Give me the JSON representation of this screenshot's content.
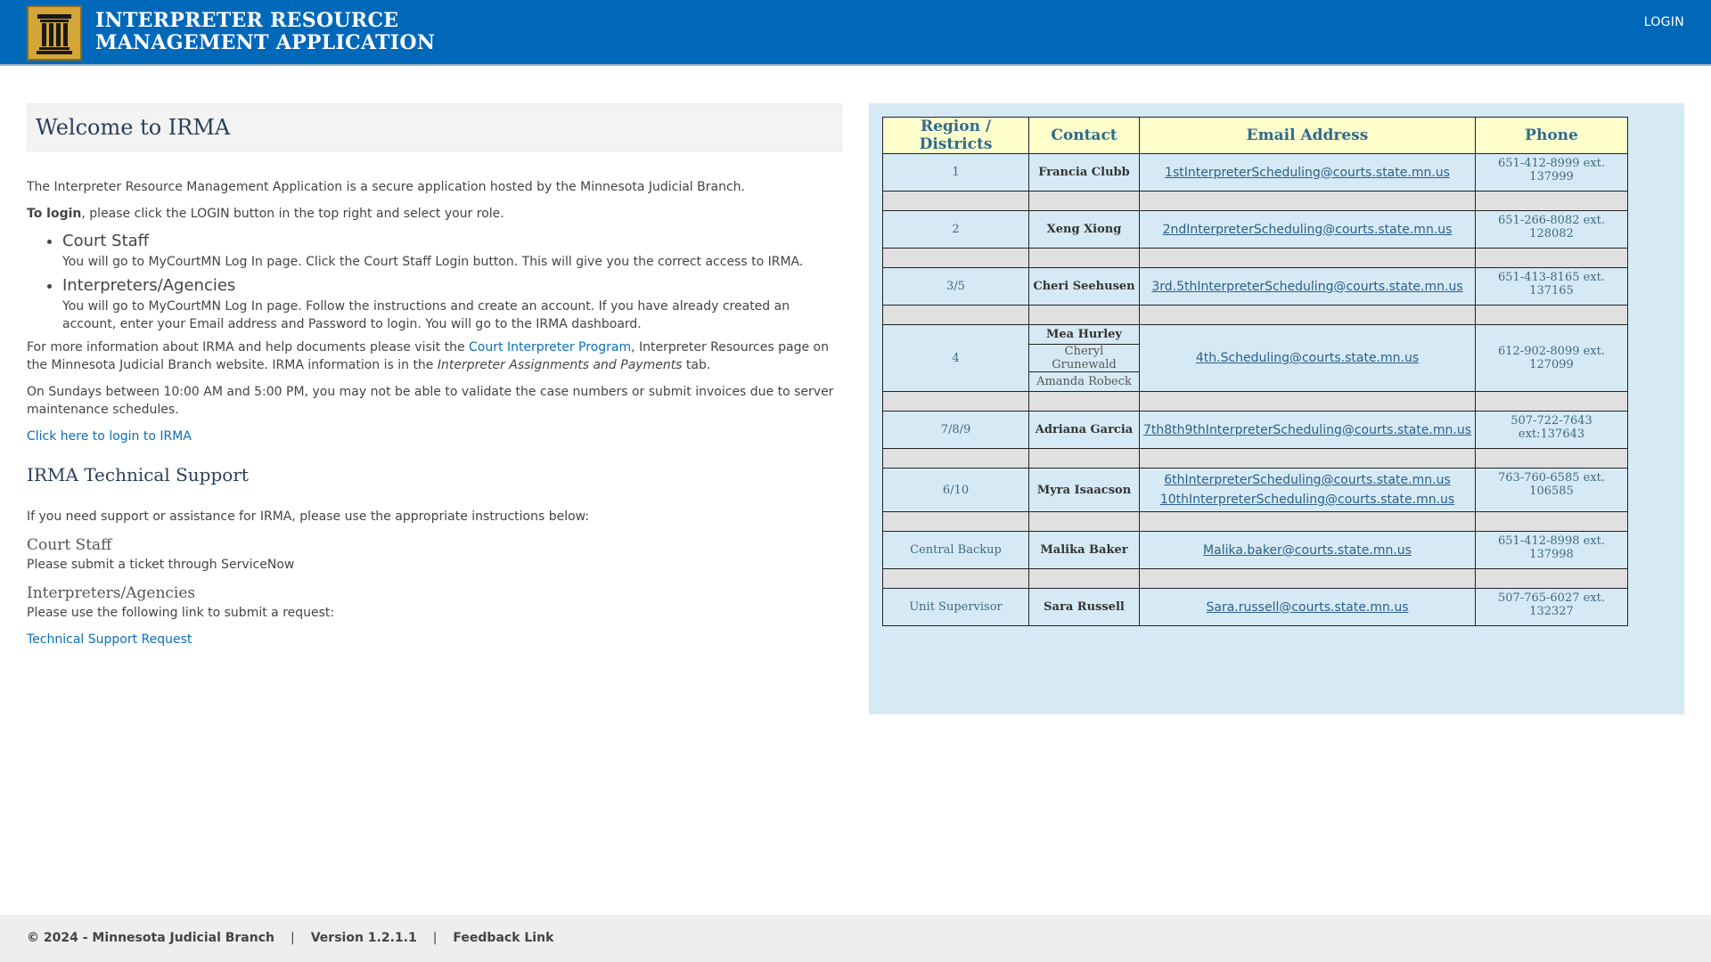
{
  "header": {
    "title_line1": "INTERPRETER RESOURCE",
    "title_line2": "MANAGEMENT APPLICATION",
    "login_label": "LOGIN",
    "logo_icon": "courthouse-pillar-icon"
  },
  "welcome": {
    "heading": "Welcome to IRMA",
    "intro": "The Interpreter Resource Management Application is a secure application hosted by the Minnesota Judicial Branch.",
    "login_bold": "To login",
    "login_rest": ", please click the LOGIN button in the top right and select your role.",
    "roles": [
      {
        "title": "Court Staff",
        "desc": "You will go to MyCourtMN Log In page. Click the Court Staff Login button. This will give you the correct access to IRMA."
      },
      {
        "title": "Interpreters/Agencies",
        "desc": "You will go to MyCourtMN Log In page. Follow the instructions and create an account. If you have already created an account, enter your Email address and Password to login. You will go to the IRMA dashboard."
      }
    ],
    "more_pre": "For more information about IRMA and help documents please visit the ",
    "more_link": "Court Interpreter Program",
    "more_mid": ", Interpreter Resources page on the Minnesota Judicial Branch website. IRMA information is in the ",
    "more_italic": "Interpreter Assignments and Payments",
    "more_post": " tab.",
    "sunday": "On Sundays between 10:00 AM and 5:00 PM, you may not be able to validate the case numbers or submit invoices due to server maintenance schedules.",
    "click_login": "Click here to login to IRMA"
  },
  "support": {
    "heading": "IRMA Technical Support",
    "intro": "If you need support or assistance for IRMA, please use the appropriate instructions below:",
    "court_staff_heading": "Court Staff",
    "court_staff_text": "Please submit a ticket through ServiceNow",
    "interp_heading": "Interpreters/Agencies",
    "interp_text": "Please use the following link to submit a request:",
    "request_link": "Technical Support Request"
  },
  "contacts_table": {
    "headers": [
      "Region / Districts",
      "Contact",
      "Email Address",
      "Phone"
    ],
    "rows": [
      {
        "region": "1",
        "contact": "Francia Clubb",
        "email": "1stInterpreterScheduling@courts.state.mn.us",
        "phone": "651-412-8999 ext. 137999"
      },
      {
        "region": "2",
        "contact": "Xeng Xiong",
        "email": "2ndInterpreterScheduling@courts.state.mn.us",
        "phone": "651-266-8082 ext. 128082"
      },
      {
        "region": "3/5",
        "contact": "Cheri Seehusen",
        "email": "3rd.5thInterpreterScheduling@courts.state.mn.us",
        "phone": "651-413-8165 ext. 137165"
      },
      {
        "region": "4",
        "contacts": [
          "Mea Hurley",
          "Cheryl Grunewald",
          "Amanda Robeck"
        ],
        "email": "4th.Scheduling@courts.state.mn.us",
        "phone": "612-902-8099 ext. 127099"
      },
      {
        "region": "7/8/9",
        "contact": "Adriana Garcia",
        "email": "7th8th9thInterpreterScheduling@courts.state.mn.us",
        "phone": "507-722-7643 ext:137643"
      },
      {
        "region": "6/10",
        "contact": "Myra Isaacson",
        "emails": [
          "6thInterpreterScheduling@courts.state.mn.us",
          "10thInterpreterScheduling@courts.state.mn.us"
        ],
        "phone": "763-760-6585 ext. 106585"
      },
      {
        "region": "Central Backup",
        "contact": "Malika Baker",
        "email": "Malika.baker@courts.state.mn.us",
        "phone": "651-412-8998 ext. 137998"
      },
      {
        "region": "Unit Supervisor",
        "contact": "Sara Russell",
        "email": "Sara.russell@courts.state.mn.us",
        "phone": "507-765-6027 ext. 132327"
      }
    ]
  },
  "footer": {
    "copyright": "© 2024 - Minnesota Judicial Branch",
    "separator": "|",
    "version": "Version 1.2.1.1",
    "feedback": "Feedback Link"
  }
}
